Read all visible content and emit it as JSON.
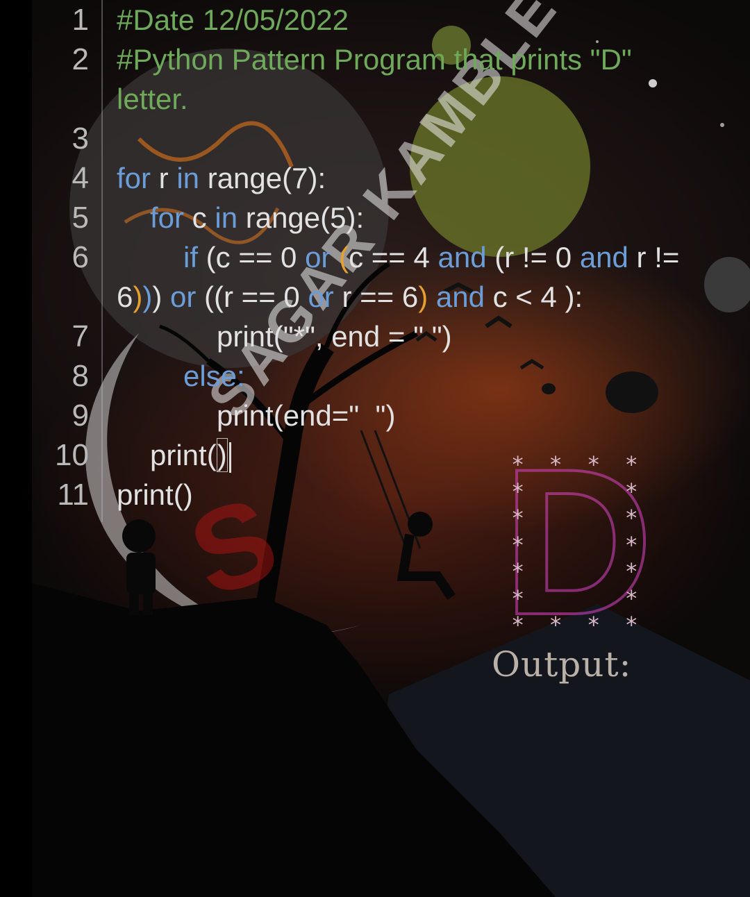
{
  "editor": {
    "line_numbers": [
      "1",
      "2",
      "3",
      "4",
      "5",
      "6",
      "7",
      "8",
      "9",
      "10",
      "11"
    ],
    "lines": {
      "l1": "#Date 12/05/2022",
      "l2a": "#Python Pattern Program that prints \"D\"",
      "l2b": "letter.",
      "l4": [
        "for",
        " r ",
        "in",
        " range(7):"
      ],
      "l5": [
        "for",
        " c ",
        "in",
        " range(5):"
      ],
      "l6a": [
        "if",
        " (c == 0 ",
        "or",
        " ",
        "(",
        "c == 4 ",
        "and",
        " (r != 0 ",
        "and",
        " r !="
      ],
      "l6b": [
        "6",
        ")",
        ")",
        ") ",
        "or",
        " ((",
        "r == 0 ",
        "or",
        " r == 6",
        ")",
        " ",
        "and",
        " c < 4 ):"
      ],
      "l7": "print(\"*\", end = \" \")",
      "l8": "else:",
      "l9": "print(end=\"  \")",
      "l10a": "print(",
      "l10b": ")",
      "l11": "print()"
    }
  },
  "watermark": {
    "text": "SAGAR KAMBLE",
    "letter": "S"
  },
  "output": {
    "label": "Output:",
    "rows": [
      "* * * *",
      "*     *",
      "*     *",
      "*     *",
      "*     *",
      "*     *",
      "* * * *"
    ],
    "big_letter": "D"
  },
  "colors": {
    "comment": "#6fa95a",
    "keyword": "#6b9ed9",
    "paren": "#e6a030",
    "text": "#e2e2e2"
  }
}
